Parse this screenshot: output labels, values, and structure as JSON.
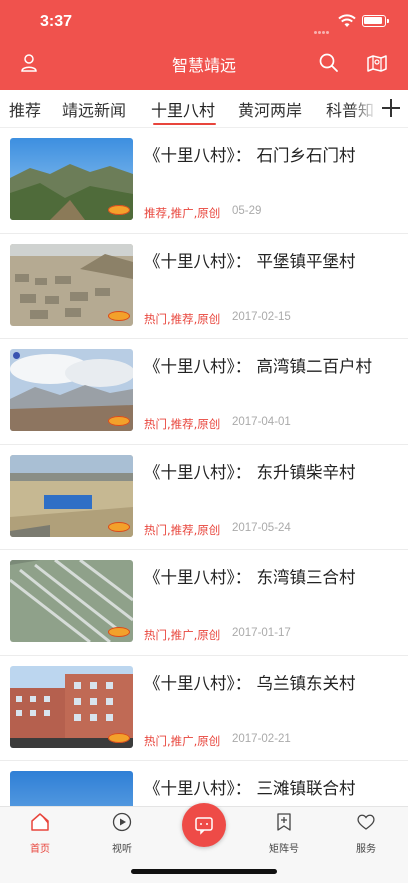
{
  "status": {
    "time": "3:37"
  },
  "header": {
    "title": "智慧靖远"
  },
  "tabs": [
    "推荐",
    "靖远新闻",
    "十里八村",
    "黄河两岸",
    "科普知"
  ],
  "active_tab_index": 2,
  "articles": [
    {
      "title": "《十里八村》： 石门乡石门村",
      "tags": "推荐,推广,原创",
      "date": "05-29"
    },
    {
      "title": "《十里八村》： 平堡镇平堡村",
      "tags": "热门,推荐,原创",
      "date": "2017-02-15"
    },
    {
      "title": "《十里八村》： 高湾镇二百户村",
      "tags": "热门,推荐,原创",
      "date": "2017-04-01"
    },
    {
      "title": "《十里八村》： 东升镇柴辛村",
      "tags": "热门,推荐,原创",
      "date": "2017-05-24"
    },
    {
      "title": "《十里八村》： 东湾镇三合村",
      "tags": "热门,推广,原创",
      "date": "2017-01-17"
    },
    {
      "title": "《十里八村》： 乌兰镇东关村",
      "tags": "热门,推广,原创",
      "date": "2017-02-21"
    },
    {
      "title": "《十里八村》： 三滩镇联合村",
      "tags": "",
      "date": ""
    }
  ],
  "bottom_nav": {
    "home": "首页",
    "video": "视听",
    "matrix": "矩阵号",
    "service": "服务"
  },
  "colors": {
    "brand": "#f0524d",
    "accent": "#e8453c"
  }
}
